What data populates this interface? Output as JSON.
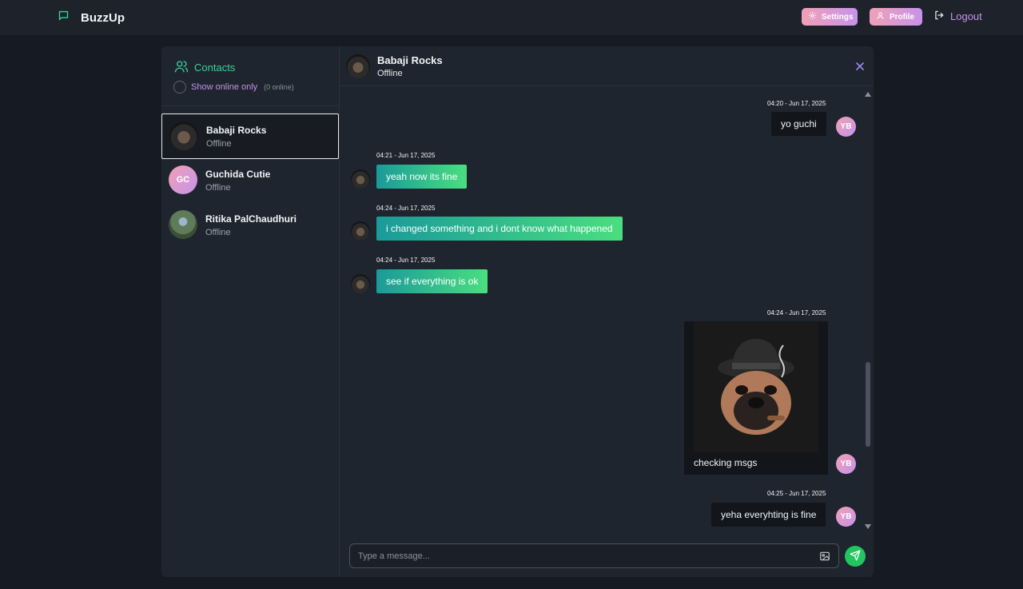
{
  "app": {
    "name": "BuzzUp"
  },
  "nav": {
    "settings": "Settings",
    "profile": "Profile",
    "logout": "Logout"
  },
  "sidebar": {
    "title": "Contacts",
    "online_toggle_label": "Show online only",
    "online_count": "(0 online)",
    "contacts": [
      {
        "name": "Babaji Rocks",
        "status": "Offline",
        "active": true
      },
      {
        "name": "Guchida Cutie",
        "status": "Offline",
        "initials": "GC"
      },
      {
        "name": "Ritika PalChaudhuri",
        "status": "Offline"
      }
    ]
  },
  "chat": {
    "name": "Babaji Rocks",
    "status": "Offline",
    "messages": [
      {
        "time": "04:20 - Jun 17, 2025",
        "text": "yo guchi",
        "sender": "me",
        "initials": "YB"
      },
      {
        "time": "04:21 - Jun 17, 2025",
        "text": "yeah now its fine",
        "sender": "them"
      },
      {
        "time": "04:24 - Jun 17, 2025",
        "text": "i changed something and i dont know what happened",
        "sender": "them"
      },
      {
        "time": "04:24 - Jun 17, 2025",
        "text": "see if everything is ok",
        "sender": "them"
      },
      {
        "time": "04:24 - Jun 17, 2025",
        "text": "checking msgs",
        "sender": "me",
        "initials": "YB",
        "has_image": true
      },
      {
        "time": "04:25 - Jun 17, 2025",
        "text": "yeha everyhting is fine",
        "sender": "me",
        "initials": "YB"
      }
    ],
    "composer_placeholder": "Type a message..."
  },
  "colors": {
    "accent_green": "#34d399",
    "accent_pink": "#f0a1b6",
    "accent_purple": "#c792ea",
    "send": "#22c55e"
  }
}
